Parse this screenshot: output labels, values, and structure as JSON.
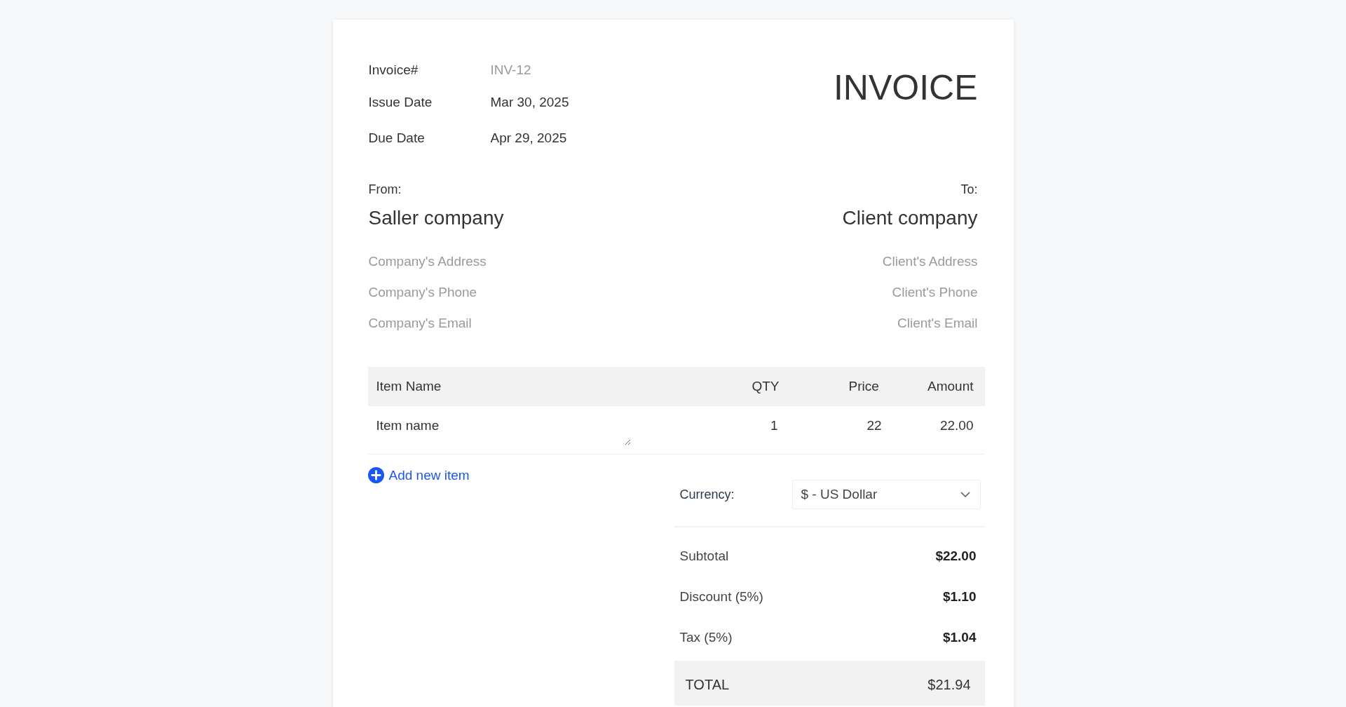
{
  "invoice": {
    "title": "INVOICE",
    "meta": [
      {
        "label": "Invoice#",
        "placeholder": "INV-12"
      },
      {
        "label": "Issue Date",
        "value": "Mar 30, 2025"
      },
      {
        "label": "Due Date",
        "value": "Apr 29, 2025"
      }
    ],
    "from": {
      "label": "From:",
      "name": "Saller company",
      "fields": [
        {
          "placeholder": "Company's Address"
        },
        {
          "placeholder": "Company's Phone"
        },
        {
          "placeholder": "Company's Email"
        }
      ]
    },
    "to": {
      "label": "To:",
      "name": "Client company",
      "fields": [
        {
          "placeholder": "Client's Address"
        },
        {
          "placeholder": "Client's Phone"
        },
        {
          "placeholder": "Client's Email"
        }
      ]
    },
    "table": {
      "columns": [
        "Item Name",
        "QTY",
        "Price",
        "Amount"
      ],
      "rows": [
        {
          "item": "Item name",
          "qty": "1",
          "price": "22",
          "amount": "22.00"
        }
      ]
    },
    "add_item": "Add new item",
    "currency": {
      "label": "Currency:",
      "value": "$ - US Dollar"
    },
    "totals": [
      {
        "label": "Subtotal",
        "value": "$22.00"
      },
      {
        "label": "Discount (5%)",
        "value": "$1.10"
      },
      {
        "label": "Tax (5%)",
        "value": "$1.04"
      }
    ],
    "total": {
      "label": "TOTAL",
      "value": "$21.94"
    }
  }
}
